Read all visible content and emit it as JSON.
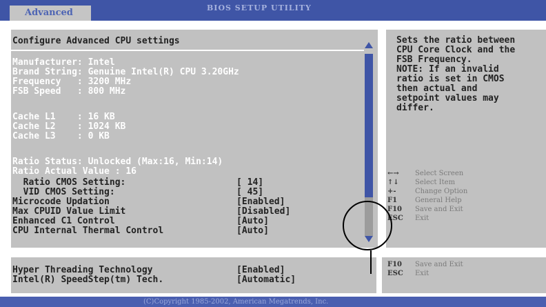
{
  "header": {
    "tab_label": "Advanced",
    "title": "BIOS SETUP UTILITY"
  },
  "main": {
    "heading": "Configure Advanced CPU settings",
    "info": [
      "Manufacturer: Intel",
      "Brand String: Genuine Intel(R) CPU 3.20GHz",
      "Frequency   : 3200 MHz",
      "FSB Speed   : 800 MHz",
      "Cache L1    : 16 KB",
      "Cache L2    : 1024 KB",
      "Cache L3    : 0 KB",
      "Ratio Status: Unlocked (Max:16, Min:14)",
      "Ratio Actual Value : 16"
    ],
    "settings": [
      {
        "label": "  Ratio CMOS Setting:",
        "value": "[ 14]"
      },
      {
        "label": "  VID CMOS Setting:",
        "value": "[ 45]"
      },
      {
        "label": "Microcode Updation",
        "value": "[Enabled]"
      },
      {
        "label": "Max CPUID Value Limit",
        "value": "[Disabled]"
      },
      {
        "label": "Enhanced C1 Control",
        "value": "[Auto]"
      },
      {
        "label": "CPU Internal Thermal Control",
        "value": "[Auto]"
      }
    ]
  },
  "help": {
    "lines": [
      "Sets the ratio between",
      "CPU Core Clock and the",
      "FSB Frequency.",
      "NOTE: If an invalid",
      "ratio is set in CMOS",
      "then actual and",
      "setpoint values may",
      "differ."
    ],
    "keys": [
      {
        "key": "←→",
        "text": "Select Screen"
      },
      {
        "key": "↑↓",
        "text": "Select Item"
      },
      {
        "key": "+-",
        "text": "Change Option"
      },
      {
        "key": "F1",
        "text": "General Help"
      },
      {
        "key": "F10",
        "text": "Save and Exit"
      },
      {
        "key": "ESC",
        "text": "Exit"
      }
    ]
  },
  "bottom": {
    "settings": [
      {
        "label": "Hyper Threading Technology",
        "value": "[Enabled]"
      },
      {
        "label": "Intel(R) SpeedStep(tm) Tech.",
        "value": "[Automatic]"
      }
    ],
    "keys": [
      {
        "key": "F10",
        "text": "Save and Exit"
      },
      {
        "key": "ESC",
        "text": "Exit"
      }
    ]
  },
  "footer": {
    "copyright": "(C)Copyright 1985-2002, American Megatrends, Inc."
  },
  "colors": {
    "bios_blue": "#3f55a6",
    "panel_gray": "#c1c1c1",
    "info_text": "#ffffff",
    "setting_text": "#222222"
  }
}
